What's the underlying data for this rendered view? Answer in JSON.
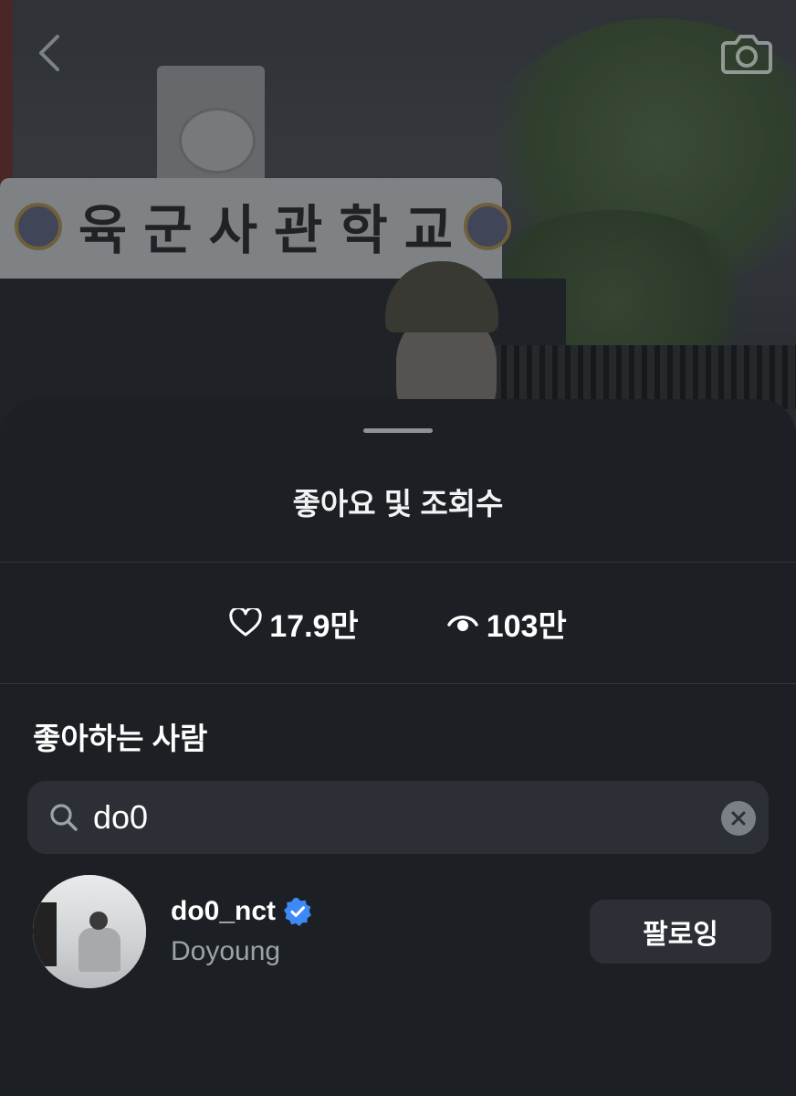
{
  "photo": {
    "sign_text": "육군사관학교"
  },
  "nav": {
    "back_icon": "chevron-left-icon",
    "camera_icon": "camera-icon"
  },
  "sheet": {
    "title": "좋아요 및 조회수",
    "stats": {
      "likes": "17.9만",
      "views": "103만"
    },
    "section_title": "좋아하는 사람",
    "search": {
      "value": "do0"
    },
    "users": [
      {
        "username": "do0_nct",
        "display_name": "Doyoung",
        "verified": true,
        "follow_label": "팔로잉"
      }
    ]
  },
  "colors": {
    "background": "#1c1f23",
    "search_bg": "#2c3036",
    "verified_blue": "#3d8af7",
    "secondary_text": "#9da2a8"
  }
}
